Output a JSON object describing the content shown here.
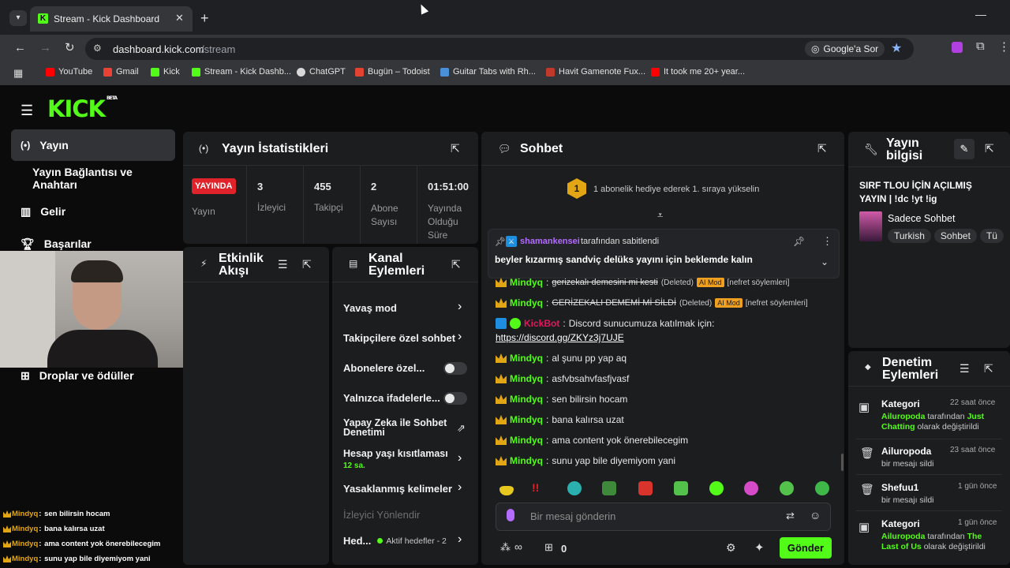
{
  "browser": {
    "tab_title": "Stream - Kick Dashboard",
    "url_domain": "dashboard.kick.com",
    "url_path": "/stream",
    "ask_google": "Google'a Sor",
    "bookmarks": [
      "YouTube",
      "Gmail",
      "Kick",
      "Stream - Kick Dashb...",
      "ChatGPT",
      "Bugün – Todoist",
      "Guitar Tabs with Rh...",
      "Havit Gamenote Fux...",
      "It took me 20+ year..."
    ]
  },
  "brand": {
    "logo": "KICK",
    "beta": "BETA",
    "accent": "#53fc18"
  },
  "sidebar": {
    "items": [
      {
        "label": "Yayın"
      },
      {
        "label": "Yayın Bağlantısı ve Anahtarı"
      },
      {
        "label": "Gelir"
      },
      {
        "label": "Başarılar"
      },
      {
        "label": "Droplar ve ödüller"
      }
    ]
  },
  "stats": {
    "title": "Yayın İstatistikleri",
    "live_badge": "YAYINDA",
    "stream_label": "Yayın",
    "viewers_value": "3",
    "viewers_label": "İzleyici",
    "followers_value": "455",
    "followers_label": "Takipçi",
    "subs_value": "2",
    "subs_label1": "Abone",
    "subs_label2": "Sayısı",
    "uptime_value": "01:51:00",
    "uptime_label1": "Yayında",
    "uptime_label2": "Olduğu",
    "uptime_label3": "Süre"
  },
  "activity": {
    "title1": "Etkinlik",
    "title2": "Akışı"
  },
  "channel_actions": {
    "title1": "Kanal",
    "title2": "Eylemleri",
    "slow_mode": "Yavaş mod",
    "followers_only": "Takipçilere özel sohbet",
    "subs_only": "Abonelere özel...",
    "emotes_only": "Yalnızca ifadelerle...",
    "ai_mod1": "Yapay Zeka ile Sohbet",
    "ai_mod2": "Denetimi",
    "age_limit": "Hesap yaşı kısıtlaması",
    "age_limit_value": "12 sa.",
    "banned_words": "Yasaklanmış kelimeler",
    "raid": "İzleyici Yönlendir",
    "goals": "Hed...",
    "goals_status": "Aktif hedefler - 2"
  },
  "chat": {
    "title": "Sohbet",
    "sub_goal_number": "1",
    "sub_goal_text": "1 abonelik hediye ederek 1. sıraya yükselin",
    "pinned_user": "shamankensei",
    "pinned_by": "tarafından sabitlendi",
    "pinned_msg": "beyler kızarmış sandviç delüks yayını için beklemde kalın",
    "messages": [
      {
        "user": "Mindyq",
        "text": "gerizekalı demesini mi kesti",
        "deleted": "(Deleted)",
        "tag": "AI Mod",
        "reason": "[nefret söylemleri]"
      },
      {
        "user": "Mindyq",
        "text": "GERİZEKALI DEMEMİ Mİ SİLDİ",
        "deleted": "(Deleted)",
        "tag": "AI Mod",
        "reason": "[nefret söylemleri]"
      },
      {
        "user": "KickBot",
        "text": "Discord sunucumuza katılmak için:",
        "link": "https://discord.gg/ZKYz3j7UJE"
      },
      {
        "user": "Mindyq",
        "text": "al şunu pp yap aq"
      },
      {
        "user": "Mindyq",
        "text": "asfvbsahvfasfjvasf"
      },
      {
        "user": "Mindyq",
        "text": "sen bilirsin hocam"
      },
      {
        "user": "Mindyq",
        "text": "bana kalırsa uzat"
      },
      {
        "user": "Mindyq",
        "text": "ama content yok önerebilecegim"
      },
      {
        "user": "Mindyq",
        "text": "sunu yap bile diyemiyom yani"
      }
    ],
    "input_placeholder": "Bir mesaj gönderin",
    "points": "0",
    "send_label": "Gönder"
  },
  "stream_info": {
    "title1": "Yayın",
    "title2": "bilgisi",
    "stream_title": "SIRF TLOU İÇİN AÇILMIŞ YAYIN | !dc !yt !ig",
    "category": "Sadece Sohbet",
    "tags": [
      "Turkish",
      "Sohbet",
      "Tü"
    ]
  },
  "moderation": {
    "title1": "Denetim",
    "title2": "Eylemleri",
    "items": [
      {
        "title": "Kategori",
        "time": "22 saat önce",
        "actor": "Ailuropoda",
        "mid": "tarafından",
        "target": "Just Chatting",
        "end": "olarak değiştirildi"
      },
      {
        "title": "Ailuropoda",
        "time": "23 saat önce",
        "desc": "bir mesajı sildi"
      },
      {
        "title": "Shefuu1",
        "time": "1 gün önce",
        "desc": "bir mesajı sildi"
      },
      {
        "title": "Kategori",
        "time": "1 gün önce",
        "actor": "Ailuropoda",
        "mid": "tarafından",
        "target": "The Last of Us",
        "end": "olarak değiştirildi"
      }
    ]
  },
  "overlay_chat": [
    {
      "user": "Mindyq",
      "text": "sen bilirsin hocam"
    },
    {
      "user": "Mindyq",
      "text": "bana kalırsa uzat"
    },
    {
      "user": "Mindyq",
      "text": "ama content yok önerebilecegim"
    },
    {
      "user": "Mindyq",
      "text": "sunu yap bile diyemiyom yani"
    }
  ]
}
